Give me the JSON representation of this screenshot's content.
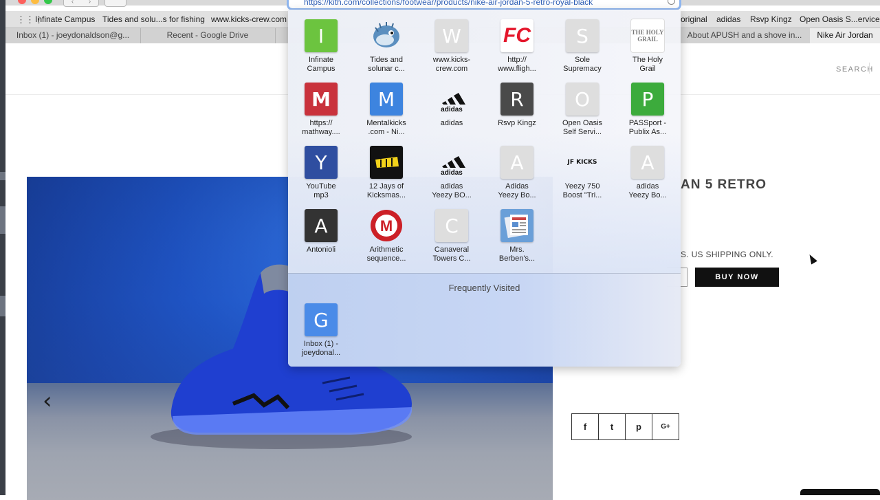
{
  "browser": {
    "url": "https://kith.com/collections/footwear/products/nike-air-jordan-5-retro-royal-black",
    "bookmarks": [
      "Infinate Campus",
      "Tides and solu...s for fishing",
      "www.kicks-crew.com",
      "original",
      "adidas",
      "Rsvp Kingz",
      "Open Oasis S...ervice (l"
    ],
    "tabs": [
      "Inbox (1) - joeydonaldson@g...",
      "Recent - Google Drive",
      "About APUSH and a shove in...",
      "Nike Air Jordan"
    ]
  },
  "favorites": {
    "items": [
      {
        "letter": "I",
        "label": "Infinate\nCampus",
        "color": "#6cc43f"
      },
      {
        "letter": "",
        "label": "Tides and\nsolunar c...",
        "color": ""
      },
      {
        "letter": "W",
        "label": "www.kicks-\ncrew.com",
        "color": "#dedede"
      },
      {
        "letter": "FC",
        "label": "http://\nwww.fligh...",
        "color": "#e4162b"
      },
      {
        "letter": "S",
        "label": "Sole\nSupremacy",
        "color": "#dedede"
      },
      {
        "letter": "THE HOLY GRAIL",
        "label": "The Holy\nGrail",
        "color": "#ffffff"
      },
      {
        "letter": "M",
        "label": "https://\nmathway....",
        "color": "#c9323c"
      },
      {
        "letter": "M",
        "label": "Mentalkicks\n.com - Ni...",
        "color": "#3d84df"
      },
      {
        "letter": "",
        "label": "adidas",
        "color": ""
      },
      {
        "letter": "R",
        "label": "Rsvp Kingz",
        "color": "#4a4a4a"
      },
      {
        "letter": "O",
        "label": "Open Oasis\nSelf Servi...",
        "color": "#dedede"
      },
      {
        "letter": "P",
        "label": "PASSport -\nPublix As...",
        "color": "#3cab3c"
      },
      {
        "letter": "Y",
        "label": "YouTube\nmp3",
        "color": "#2f4ea0"
      },
      {
        "letter": "",
        "label": "12 Jays of\nKicksmas...",
        "color": "#111111"
      },
      {
        "letter": "",
        "label": "adidas\nYeezy BO...",
        "color": ""
      },
      {
        "letter": "A",
        "label": "Adidas\nYeezy Bo...",
        "color": "#dedede"
      },
      {
        "letter": "JF KICKS",
        "label": "Yeezy 750\nBoost \"Tri...",
        "color": ""
      },
      {
        "letter": "A",
        "label": "adidas\nYeezy Bo...",
        "color": "#dedede"
      },
      {
        "letter": "A",
        "label": "Antonioli",
        "color": "#333333"
      },
      {
        "letter": "M",
        "label": "Arithmetic\nsequence...",
        "color": "#cc2027"
      },
      {
        "letter": "C",
        "label": "Canaveral\nTowers C...",
        "color": "#dedede"
      },
      {
        "letter": "",
        "label": "Mrs.\nBerben's...",
        "color": ""
      }
    ],
    "frequently_visited_title": "Frequently Visited",
    "frequent": [
      {
        "letter": "G",
        "label": "Inbox (1) -\njoeydonal...",
        "color": "#4a8be8"
      }
    ]
  },
  "page": {
    "search_label": "SEARCH",
    "product_title": "AN 5 RETRO",
    "shipping_note": "S. US SHIPPING ONLY.",
    "buy_now_label": "BUY NOW",
    "prev_arrow": "‹",
    "share": [
      "f",
      "t",
      "p",
      "G+"
    ]
  }
}
